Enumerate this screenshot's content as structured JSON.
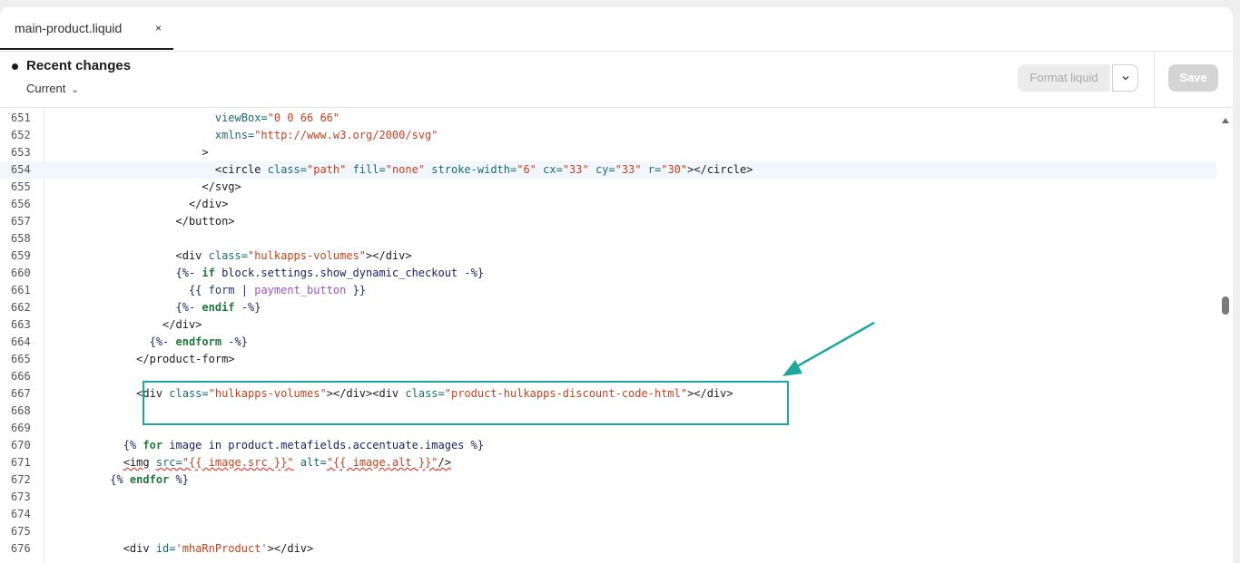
{
  "tab": {
    "label": "main-product.liquid",
    "close": "×"
  },
  "header": {
    "title": "Recent changes",
    "version_select": "Current",
    "format_label": "Format liquid",
    "save_label": "Save"
  },
  "colors": {
    "accent": "#1ea79d",
    "active_line": "#f1f7fd"
  },
  "icons": {
    "close": "close-icon",
    "chevron": "chevron-down-icon",
    "scroll_up": "scroll-up-icon"
  },
  "editor": {
    "active_line": "654",
    "line_numbers": [
      "651",
      "652",
      "653",
      "654",
      "655",
      "656",
      "657",
      "658",
      "659",
      "660",
      "661",
      "662",
      "663",
      "664",
      "665",
      "666",
      "667",
      "668",
      "669",
      "670",
      "671",
      "672",
      "673",
      "674",
      "675",
      "676"
    ],
    "lines": [
      [
        {
          "t": "                          viewBox=",
          "c": "cm-attr"
        },
        {
          "t": "\"0 0 66 66\"",
          "c": "cm-str"
        }
      ],
      [
        {
          "t": "                          xmlns=",
          "c": "cm-attr"
        },
        {
          "t": "\"http://www.w3.org/2000/svg\"",
          "c": "cm-str"
        }
      ],
      [
        {
          "t": "                        >",
          "c": "cm-tag"
        }
      ],
      [
        {
          "t": "                          <circle ",
          "c": "cm-tag"
        },
        {
          "t": "class=",
          "c": "cm-attr"
        },
        {
          "t": "\"path\"",
          "c": "cm-str"
        },
        {
          "t": " fill=",
          "c": "cm-attr"
        },
        {
          "t": "\"none\"",
          "c": "cm-str"
        },
        {
          "t": " stroke-width=",
          "c": "cm-attr"
        },
        {
          "t": "\"6\"",
          "c": "cm-str"
        },
        {
          "t": " cx=",
          "c": "cm-attr"
        },
        {
          "t": "\"33\"",
          "c": "cm-str"
        },
        {
          "t": " cy=",
          "c": "cm-attr"
        },
        {
          "t": "\"33\"",
          "c": "cm-str"
        },
        {
          "t": " r=",
          "c": "cm-attr"
        },
        {
          "t": "\"30\"",
          "c": "cm-str"
        },
        {
          "t": "></circle>",
          "c": "cm-tag"
        }
      ],
      [
        {
          "t": "                        </svg>",
          "c": "cm-tag"
        }
      ],
      [
        {
          "t": "                      </div>",
          "c": "cm-tag"
        }
      ],
      [
        {
          "t": "                    </button>",
          "c": "cm-tag"
        }
      ],
      [
        {
          "t": "",
          "c": "cm-tag"
        }
      ],
      [
        {
          "t": "                    <div ",
          "c": "cm-tag"
        },
        {
          "t": "class=",
          "c": "cm-attr"
        },
        {
          "t": "\"hulkapps-volumes\"",
          "c": "cm-str"
        },
        {
          "t": "></div>",
          "c": "cm-tag"
        }
      ],
      [
        {
          "t": "                    {%- ",
          "c": "cm-liq"
        },
        {
          "t": "if",
          "c": "cm-kw"
        },
        {
          "t": " block.settings.show_dynamic_checkout -%}",
          "c": "cm-liq"
        }
      ],
      [
        {
          "t": "                      {{ ",
          "c": "cm-liq"
        },
        {
          "t": "form",
          "c": "cm-var"
        },
        {
          "t": " | ",
          "c": "cm-liq"
        },
        {
          "t": "payment_button",
          "c": "cm-filter"
        },
        {
          "t": " }}",
          "c": "cm-liq"
        }
      ],
      [
        {
          "t": "                    {%- ",
          "c": "cm-liq"
        },
        {
          "t": "endif",
          "c": "cm-kw"
        },
        {
          "t": " -%}",
          "c": "cm-liq"
        }
      ],
      [
        {
          "t": "                  </div>",
          "c": "cm-tag"
        }
      ],
      [
        {
          "t": "                {%- ",
          "c": "cm-liq"
        },
        {
          "t": "endform",
          "c": "cm-kw"
        },
        {
          "t": " -%}",
          "c": "cm-liq"
        }
      ],
      [
        {
          "t": "              </product-form>",
          "c": "cm-tag"
        }
      ],
      [
        {
          "t": "",
          "c": "cm-tag"
        }
      ],
      [
        {
          "t": "              <div ",
          "c": "cm-tag"
        },
        {
          "t": "class=",
          "c": "cm-attr"
        },
        {
          "t": "\"hulkapps-volumes\"",
          "c": "cm-str"
        },
        {
          "t": "></div><div ",
          "c": "cm-tag"
        },
        {
          "t": "class=",
          "c": "cm-attr"
        },
        {
          "t": "\"product-hulkapps-discount-code-html\"",
          "c": "cm-str"
        },
        {
          "t": "></div>",
          "c": "cm-tag"
        }
      ],
      [
        {
          "t": "",
          "c": "cm-tag"
        }
      ],
      [
        {
          "t": "",
          "c": "cm-tag"
        }
      ],
      [
        {
          "t": "            {% ",
          "c": "cm-liq"
        },
        {
          "t": "for",
          "c": "cm-kw"
        },
        {
          "t": " image in product.metafields.accentuate.images %}",
          "c": "cm-liq"
        }
      ],
      [
        {
          "t": "            ",
          "c": "cm-tag"
        },
        {
          "t": "<img",
          "c": "cm-tag squig"
        },
        {
          "t": " ",
          "c": "cm-tag"
        },
        {
          "t": "src=",
          "c": "cm-attr squig"
        },
        {
          "t": "\"{{ image.src }}\"",
          "c": "cm-str squig"
        },
        {
          "t": " alt=",
          "c": "cm-attr"
        },
        {
          "t": "\"{{ image.alt }}\"",
          "c": "cm-str squig"
        },
        {
          "t": "/>",
          "c": "cm-tag squig"
        }
      ],
      [
        {
          "t": "          {% ",
          "c": "cm-liq"
        },
        {
          "t": "endfor",
          "c": "cm-kw"
        },
        {
          "t": " %}",
          "c": "cm-liq"
        }
      ],
      [
        {
          "t": "",
          "c": "cm-tag"
        }
      ],
      [
        {
          "t": "",
          "c": "cm-tag"
        }
      ],
      [
        {
          "t": "",
          "c": "cm-tag"
        }
      ],
      [
        {
          "t": "            <div ",
          "c": "cm-tag"
        },
        {
          "t": "id=",
          "c": "cm-attr"
        },
        {
          "t": "'mhaRnProduct'",
          "c": "cm-str"
        },
        {
          "t": "></div>",
          "c": "cm-tag"
        }
      ]
    ]
  }
}
